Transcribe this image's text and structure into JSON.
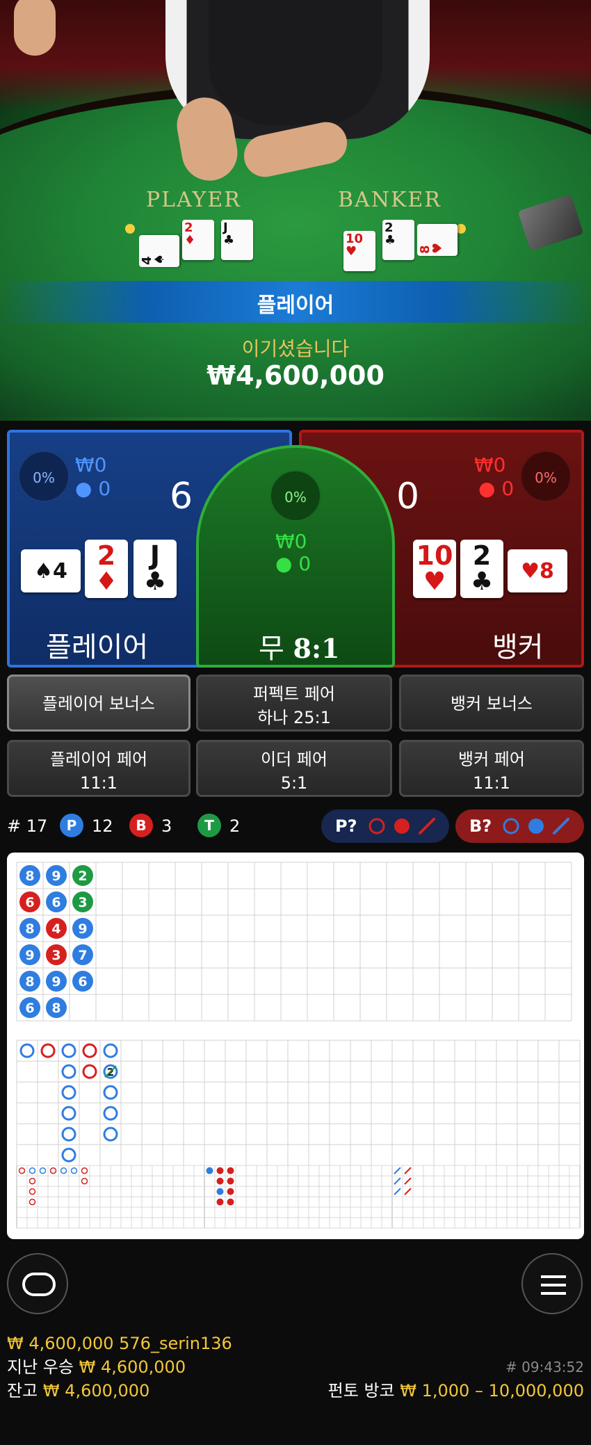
{
  "video": {
    "table_player_label": "PLAYER",
    "table_banker_label": "BANKER",
    "result_title": "플레이어",
    "win_text": "이기셨습니다",
    "win_amount": "₩4,600,000",
    "table_cards_player": [
      {
        "rank": "4",
        "suit": "♠",
        "red": false
      },
      {
        "rank": "2",
        "suit": "♦",
        "red": true
      },
      {
        "rank": "J",
        "suit": "♣",
        "red": false
      }
    ],
    "table_cards_banker": [
      {
        "rank": "10",
        "suit": "♥",
        "red": true
      },
      {
        "rank": "2",
        "suit": "♣",
        "red": false
      },
      {
        "rank": "8",
        "suit": "♥",
        "red": true
      }
    ]
  },
  "player": {
    "pct": "0%",
    "bet": "₩0",
    "count": "0",
    "score": "6",
    "label": "플레이어",
    "color": "#2f74e0",
    "cards": [
      {
        "rank": "4",
        "suit": "♠",
        "red": false,
        "sideways": true
      },
      {
        "rank": "2",
        "suit": "♦",
        "red": true,
        "sideways": false
      },
      {
        "rank": "J",
        "suit": "♣",
        "red": false,
        "sideways": false
      }
    ]
  },
  "tie": {
    "pct": "0%",
    "bet": "₩0",
    "count": "0",
    "label": "무",
    "payout": "8:1",
    "color": "#2fae3a"
  },
  "banker": {
    "pct": "0%",
    "bet": "₩0",
    "count": "0",
    "score": "0",
    "label": "뱅커",
    "color": "#b31717",
    "cards": [
      {
        "rank": "10",
        "suit": "♥",
        "red": true,
        "sideways": false
      },
      {
        "rank": "2",
        "suit": "♣",
        "red": false,
        "sideways": false
      },
      {
        "rank": "8",
        "suit": "♥",
        "red": true,
        "sideways": true
      }
    ]
  },
  "side_bets": {
    "player_bonus": "플레이어 보너스",
    "perfect_pair_line1": "퍼펙트 페어",
    "perfect_pair_line2": "하나 25:1",
    "banker_bonus": "뱅커 보너스",
    "player_pair_line1": "플레이어 페어",
    "player_pair_line2": "11:1",
    "either_pair_line1": "이더 페어",
    "either_pair_line2": "5:1",
    "banker_pair_line1": "뱅커 페어",
    "banker_pair_line2": "11:1"
  },
  "stats": {
    "rounds": "# 17",
    "player_letter": "P",
    "player_count": "12",
    "banker_letter": "B",
    "banker_count": "3",
    "tie_letter": "T",
    "tie_count": "2",
    "player_ask": "P?",
    "banker_ask": "B?",
    "colors": {
      "player": "#2f7de0",
      "banker": "#d62020",
      "tie": "#1f9a44"
    }
  },
  "bead_road": [
    [
      {
        "n": "8",
        "c": "P"
      },
      {
        "n": "6",
        "c": "B"
      },
      {
        "n": "8",
        "c": "P"
      },
      {
        "n": "9",
        "c": "P"
      },
      {
        "n": "8",
        "c": "P"
      },
      {
        "n": "6",
        "c": "P"
      }
    ],
    [
      {
        "n": "9",
        "c": "P"
      },
      {
        "n": "6",
        "c": "P"
      },
      {
        "n": "4",
        "c": "B"
      },
      {
        "n": "3",
        "c": "B"
      },
      {
        "n": "9",
        "c": "P"
      },
      {
        "n": "8",
        "c": "P"
      }
    ],
    [
      {
        "n": "2",
        "c": "T"
      },
      {
        "n": "3",
        "c": "T"
      },
      {
        "n": "9",
        "c": "P"
      },
      {
        "n": "7",
        "c": "P"
      },
      {
        "n": "6",
        "c": "P"
      }
    ]
  ],
  "big_road": [
    [
      "P"
    ],
    [
      "B"
    ],
    [
      "P",
      "P",
      "P",
      "P",
      "P",
      "P"
    ],
    [
      "B",
      "B"
    ],
    [
      "P",
      "P2",
      "P",
      "P",
      "P"
    ]
  ],
  "footer": {
    "win_line": "₩ 4,600,000 576_serin136",
    "last_win_label": "지난 우승",
    "last_win_value": "₩ 4,600,000",
    "balance_label": "잔고",
    "balance_value": "₩ 4,600,000",
    "time": "# 09:43:52",
    "limits_label": "펀토 방코",
    "limits_value": "₩ 1,000 – 10,000,000"
  }
}
